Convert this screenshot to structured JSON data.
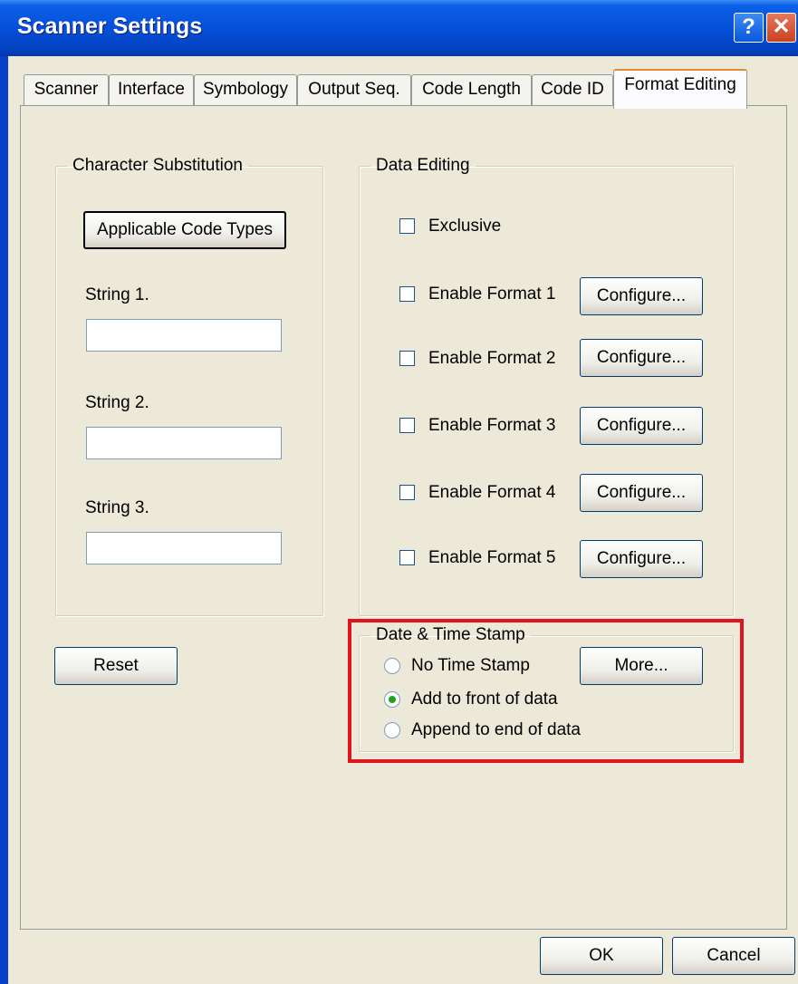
{
  "window": {
    "title": "Scanner Settings",
    "help_label": "?",
    "close_label": "✕"
  },
  "tabs": [
    "Scanner",
    "Interface",
    "Symbology",
    "Output Seq.",
    "Code Length",
    "Code ID",
    "Format Editing"
  ],
  "active_tab": "Format Editing",
  "char_sub": {
    "legend": "Character Substitution",
    "code_types_button": "Applicable Code Types",
    "string1_label": "String 1.",
    "string1_value": "",
    "string2_label": "String 2.",
    "string2_value": "",
    "string3_label": "String 3.",
    "string3_value": ""
  },
  "reset_label": "Reset",
  "data_editing": {
    "legend": "Data Editing",
    "exclusive_label": "Exclusive",
    "formats": [
      {
        "label": "Enable Format 1",
        "button": "Configure...",
        "checked": false
      },
      {
        "label": "Enable Format 2",
        "button": "Configure...",
        "checked": false
      },
      {
        "label": "Enable Format 3",
        "button": "Configure...",
        "checked": false
      },
      {
        "label": "Enable Format 4",
        "button": "Configure...",
        "checked": false
      },
      {
        "label": "Enable Format 5",
        "button": "Configure...",
        "checked": false
      }
    ]
  },
  "timestamp": {
    "legend": "Date & Time Stamp",
    "options": [
      "No Time Stamp",
      "Add to front of data",
      "Append to end of data"
    ],
    "selected": "Add to front of data",
    "more_label": "More..."
  },
  "footer": {
    "ok_label": "OK",
    "cancel_label": "Cancel"
  },
  "colors": {
    "title_blue": "#0650d8",
    "highlight_red": "#e1141c",
    "dialog_bg": "#ece9d8"
  }
}
